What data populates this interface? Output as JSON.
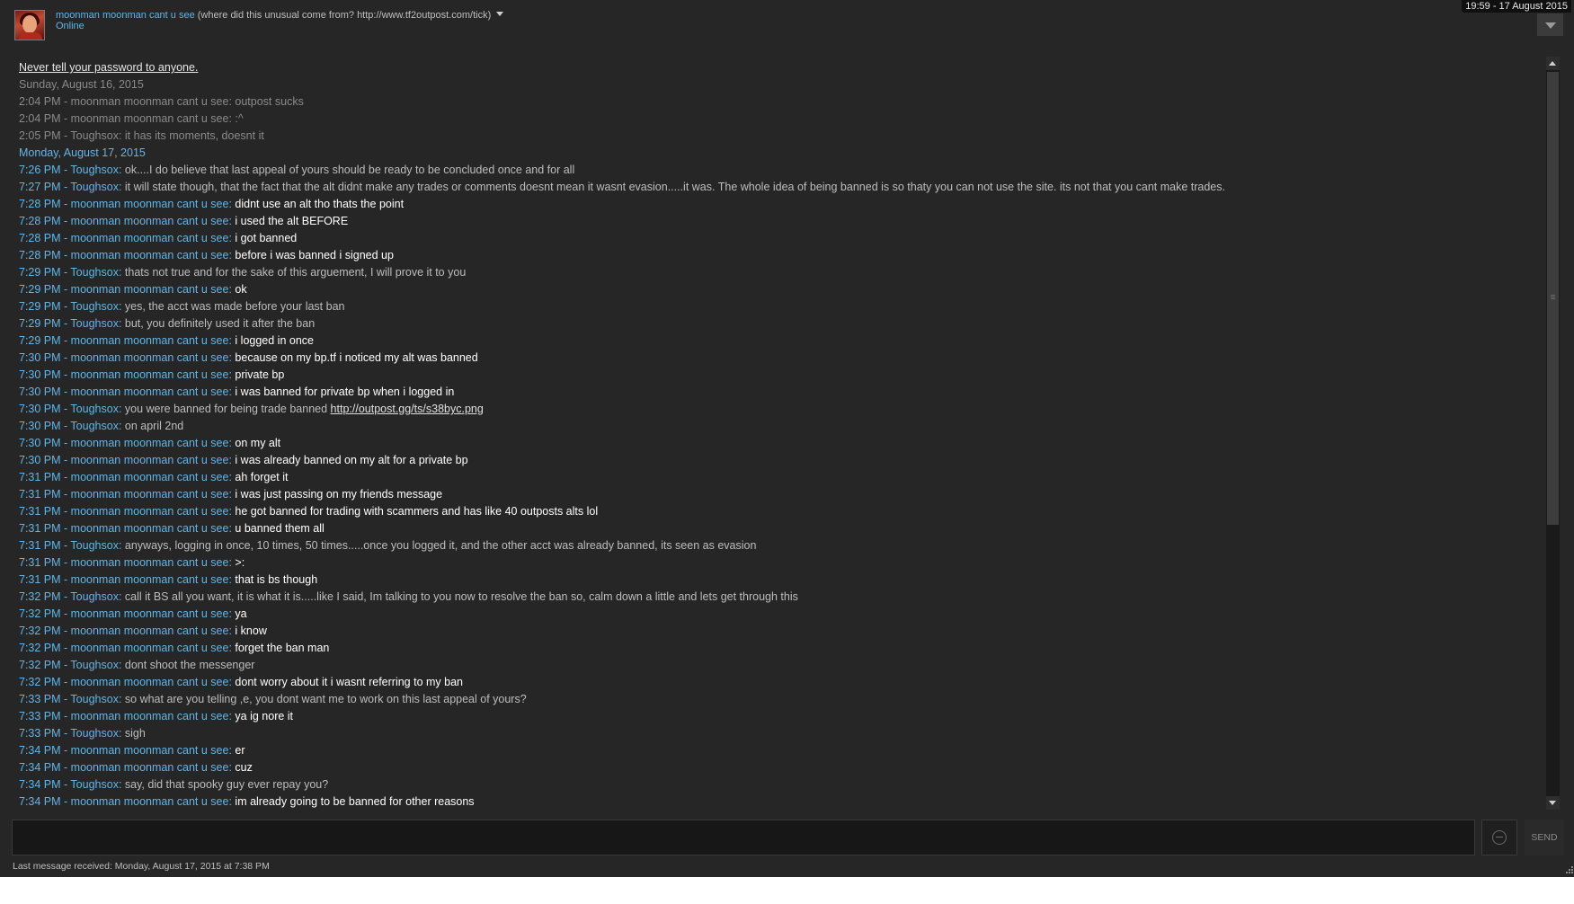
{
  "header": {
    "friend_name": "moonman moonman cant u see",
    "friend_game": " (where did this unusual come from? http://www.tf2outpost.com/tick)",
    "friend_status": "Online",
    "clock": "19:59 - 17 August 2015"
  },
  "chat": {
    "warning": "Never tell your password to anyone.",
    "date_old": "Sunday, August 16, 2015",
    "date_new": "Monday, August 17, 2015",
    "old_messages": [
      "2:04 PM - moonman moonman cant u see: outpost sucks",
      "2:04 PM - moonman moonman cant u see: :^",
      "2:05 PM - Toughsox: it has its moments, doesnt it"
    ],
    "messages": [
      {
        "prefix": "7:26 PM - Toughsox:",
        "text": " ok....I do believe that last appeal of yours should be ready to be concluded once and for all",
        "me": false
      },
      {
        "prefix": "7:27 PM - Toughsox:",
        "text": " it will state though, that the fact that the alt didnt make any trades or comments doesnt mean it wasnt evasion.....it was.  The whole idea of being banned is so thaty you can not use the site. its not that you cant make trades.",
        "me": false
      },
      {
        "prefix": "7:28 PM - moonman moonman cant u see:",
        "text": " didnt use an alt tho thats the point",
        "me": true
      },
      {
        "prefix": "7:28 PM - moonman moonman cant u see:",
        "text": " i used the alt BEFORE",
        "me": true
      },
      {
        "prefix": "7:28 PM - moonman moonman cant u see:",
        "text": " i got banned",
        "me": true
      },
      {
        "prefix": "7:28 PM - moonman moonman cant u see:",
        "text": " before i was banned i signed up",
        "me": true
      },
      {
        "prefix": "7:29 PM - Toughsox:",
        "text": " thats not true and for the sake of this arguement, I will prove it to you",
        "me": false
      },
      {
        "prefix": "7:29 PM - moonman moonman cant u see:",
        "text": " ok",
        "me": true
      },
      {
        "prefix": "7:29 PM - Toughsox:",
        "text": " yes, the acct was made before your last ban",
        "me": false
      },
      {
        "prefix": "7:29 PM - Toughsox:",
        "text": " but, you definitely used it after the ban",
        "me": false
      },
      {
        "prefix": "7:29 PM - moonman moonman cant u see:",
        "text": " i logged in once",
        "me": true
      },
      {
        "prefix": "7:30 PM - moonman moonman cant u see:",
        "text": " because on my bp.tf i noticed my alt was banned",
        "me": true
      },
      {
        "prefix": "7:30 PM - moonman moonman cant u see:",
        "text": " private bp",
        "me": true
      },
      {
        "prefix": "7:30 PM - moonman moonman cant u see:",
        "text": " i was banned for private bp when i logged in",
        "me": true
      },
      {
        "prefix": "7:30 PM - Toughsox:",
        "text": " you were banned for being trade banned  ",
        "link": "http://outpost.gg/ts/s38byc.png",
        "me": false
      },
      {
        "prefix": "7:30 PM - Toughsox:",
        "text": " on april 2nd",
        "me": false
      },
      {
        "prefix": "7:30 PM - moonman moonman cant u see:",
        "text": " on my alt",
        "me": true
      },
      {
        "prefix": "7:30 PM - moonman moonman cant u see:",
        "text": " i was already banned on my alt for a private bp",
        "me": true
      },
      {
        "prefix": "7:31 PM - moonman moonman cant u see:",
        "text": " ah forget it",
        "me": true
      },
      {
        "prefix": "7:31 PM - moonman moonman cant u see:",
        "text": " i was just passing on my friends message",
        "me": true
      },
      {
        "prefix": "7:31 PM - moonman moonman cant u see:",
        "text": " he got banned for trading with scammers and has like 40 outposts alts lol",
        "me": true
      },
      {
        "prefix": "7:31 PM - moonman moonman cant u see:",
        "text": " u banned them all",
        "me": true
      },
      {
        "prefix": "7:31 PM - Toughsox:",
        "text": " anyways, logging in once, 10 times, 50 times.....once you logged it, and the other acct was already banned, its seen as evasion",
        "me": false
      },
      {
        "prefix": "7:31 PM - moonman moonman cant u see:",
        "text": " >:",
        "me": true
      },
      {
        "prefix": "7:31 PM - moonman moonman cant u see:",
        "text": " that  is bs though",
        "me": true
      },
      {
        "prefix": "7:32 PM - Toughsox:",
        "text": " call it BS all you want, it is what it is.....like I said, Im talking to you now to resolve the ban so, calm down a little and lets get through this",
        "me": false
      },
      {
        "prefix": "7:32 PM - moonman moonman cant u see:",
        "text": " ya",
        "me": true
      },
      {
        "prefix": "7:32 PM - moonman moonman cant u see:",
        "text": " i know",
        "me": true
      },
      {
        "prefix": "7:32 PM - moonman moonman cant u see:",
        "text": " forget the ban man",
        "me": true
      },
      {
        "prefix": "7:32 PM - Toughsox:",
        "text": " dont shoot the messenger",
        "me": false
      },
      {
        "prefix": "7:32 PM - moonman moonman cant u see:",
        "text": " dont worry about it i wasnt referring to my ban",
        "me": true
      },
      {
        "prefix": "7:33 PM - Toughsox:",
        "text": " so what are you telling ,e, you dont want me to work on this last appeal of yours?",
        "me": false
      },
      {
        "prefix": "7:33 PM - moonman moonman cant u see:",
        "text": " ya ig nore it",
        "me": true
      },
      {
        "prefix": "7:33 PM - Toughsox:",
        "text": " sigh",
        "me": false
      },
      {
        "prefix": "7:34 PM - moonman moonman cant u see:",
        "text": " er",
        "me": true
      },
      {
        "prefix": "7:34 PM - moonman moonman cant u see:",
        "text": " cuz",
        "me": true
      },
      {
        "prefix": "7:34 PM - Toughsox:",
        "text": " say, did that spooky guy ever repay you?",
        "me": false
      },
      {
        "prefix": "7:34 PM - moonman moonman cant u see:",
        "text": " im already going to be banned for other reasons",
        "me": true
      }
    ]
  },
  "composer": {
    "input_value": "",
    "send_label": "SEND",
    "emote_icon": "emoticon-icon"
  },
  "footer": {
    "last_message": "Last message received: Monday, August 17, 2015 at 7:38 PM"
  },
  "colors": {
    "background": "#262626",
    "accent_blue": "#62b5e8",
    "own_message": "#ffffff",
    "other_message": "#bdbdbd",
    "history": "#8a8a8a"
  }
}
